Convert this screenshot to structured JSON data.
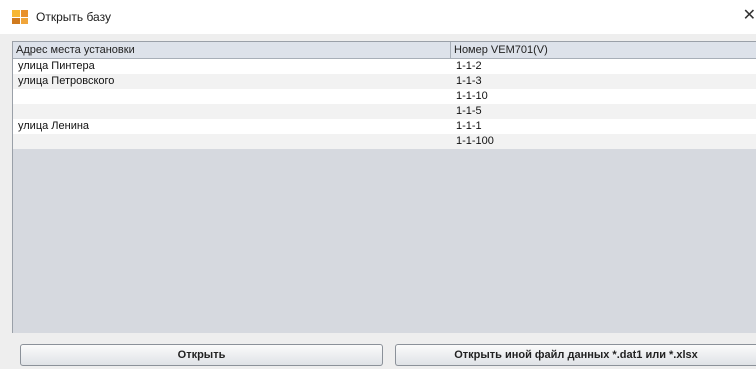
{
  "window": {
    "title": "Открыть базу",
    "close_glyph": "✕",
    "app_icon": "folder-grid-icon"
  },
  "table": {
    "columns": [
      "Адрес места установки",
      "Номер VEM701(V)"
    ],
    "rows": [
      {
        "address": "улица Пинтера",
        "number": "1-1-2"
      },
      {
        "address": "улица Петровского",
        "number": "1-1-3"
      },
      {
        "address": "",
        "number": "1-1-10"
      },
      {
        "address": "",
        "number": "1-1-5"
      },
      {
        "address": "улица Ленина",
        "number": "1-1-1"
      },
      {
        "address": "",
        "number": "1-1-100"
      }
    ]
  },
  "buttons": {
    "open_label": "Открыть",
    "open_other_label": "Открыть иной файл данных *.dat1 или *.xlsx"
  },
  "colors": {
    "table_background": "#d6d9df",
    "header_background": "#dde2ea",
    "window_background": "#eeeeee"
  }
}
